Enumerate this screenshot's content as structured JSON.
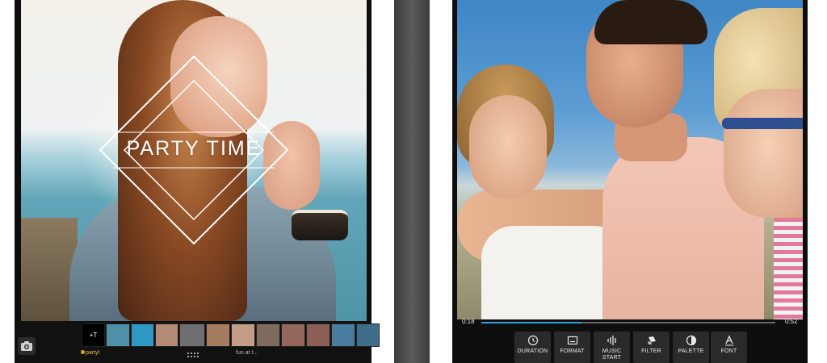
{
  "left_screen": {
    "overlay_title": "PARTY TIME",
    "thumbnails": [
      {
        "kind": "text",
        "label": "+T",
        "color": "#000000"
      },
      {
        "kind": "photo",
        "color": "#4f8fa8"
      },
      {
        "kind": "photo",
        "color": "#2f98c4"
      },
      {
        "kind": "photo",
        "color": "#b48b77"
      },
      {
        "kind": "photo",
        "color": "#6f6f6f"
      },
      {
        "kind": "photo",
        "color": "#a57c5f"
      },
      {
        "kind": "photo",
        "color": "#c59d86"
      },
      {
        "kind": "photo",
        "color": "#7f6a5d"
      },
      {
        "kind": "photo",
        "color": "#93685a"
      },
      {
        "kind": "photo",
        "color": "#8b5e56"
      },
      {
        "kind": "photo",
        "color": "#4a7c9f"
      },
      {
        "kind": "photo",
        "color": "#3f6d8c"
      }
    ],
    "thumb_caption_1": "party!",
    "thumb_caption_2": "fun at t..."
  },
  "right_screen": {
    "playback": {
      "current_time": "0:18",
      "total_time": "0:52",
      "progress": 0.34
    },
    "tools": [
      {
        "id": "duration",
        "label": "DURATION",
        "icon": "clock-icon"
      },
      {
        "id": "format",
        "label": "FORMAT",
        "icon": "format-icon"
      },
      {
        "id": "music-start",
        "label": "MUSIC START",
        "icon": "waveform-icon"
      },
      {
        "id": "filter",
        "label": "FILTER",
        "icon": "filter-icon"
      },
      {
        "id": "palette",
        "label": "PALETTE",
        "icon": "palette-icon"
      },
      {
        "id": "font",
        "label": "FONT",
        "icon": "font-icon"
      }
    ]
  },
  "colors": {
    "accent": "#3aa0e0",
    "toolbar_bg": "#111111",
    "tool_button_bg": "#2a2a2a",
    "caption_yellow": "#e5c04e"
  }
}
